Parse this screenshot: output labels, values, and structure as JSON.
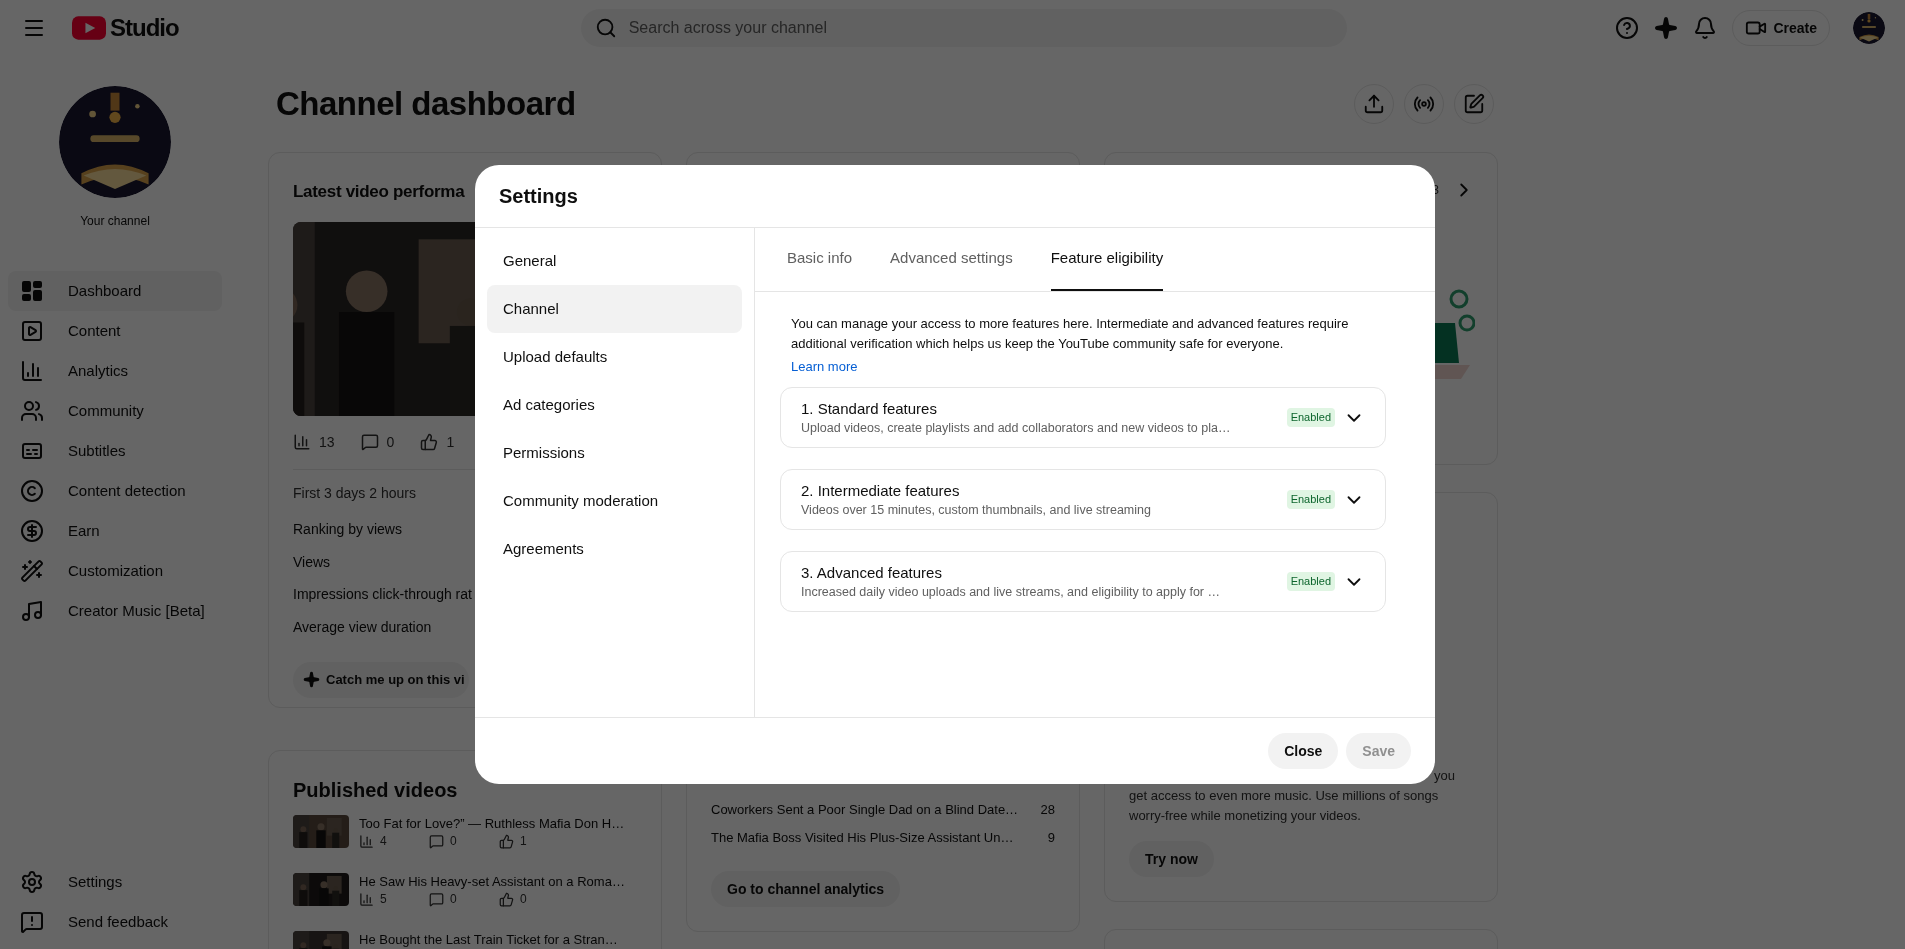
{
  "topbar": {
    "logo": "Studio",
    "search": {
      "placeholder": "Search across your channel"
    },
    "create_button": "Create"
  },
  "sidebar": {
    "channel_label": "Your channel",
    "items": [
      {
        "label": "Dashboard",
        "selected": true
      },
      {
        "label": "Content",
        "selected": false
      },
      {
        "label": "Analytics",
        "selected": false
      },
      {
        "label": "Community",
        "selected": false
      },
      {
        "label": "Subtitles",
        "selected": false
      },
      {
        "label": "Content detection",
        "selected": false
      },
      {
        "label": "Earn",
        "selected": false
      },
      {
        "label": "Customization",
        "selected": false
      },
      {
        "label": "Creator Music [Beta]",
        "selected": false
      }
    ],
    "footer_items": [
      "Settings",
      "Send feedback"
    ]
  },
  "page": {
    "title": "Channel dashboard"
  },
  "latest_video": {
    "title": "Latest video performa",
    "stats": [
      "13",
      "0",
      "1"
    ],
    "period": "First 3 days 2 hours",
    "metrics": [
      "Ranking by views",
      "Views",
      "Impressions click-through rat",
      "Average view duration"
    ],
    "button": "Catch me up on this vi"
  },
  "published_videos": {
    "title": "Published videos",
    "videos": [
      {
        "title": "Too Fat for Love?” — Ruthless Mafia Don H…",
        "stats": [
          "4",
          "0",
          "1"
        ]
      },
      {
        "title": "He Saw His Heavy-set Assistant on a Roma…",
        "stats": [
          "5",
          "0",
          "0"
        ]
      },
      {
        "title": "He Bought the Last Train Ticket for a Stran…"
      }
    ]
  },
  "top_videos": {
    "rows": [
      {
        "title": "Coworkers Sent a Poor Single Dad on a Blind Date…",
        "views": "28"
      },
      {
        "title": "The Mafia Boss Visited His Plus-Size Assistant Un…",
        "views": "9"
      }
    ],
    "button": "Go to channel analytics"
  },
  "news_card": {
    "page_indicator": "3"
  },
  "music_card": {
    "lines": [
      "you",
      "get access to even more music. Use millions of songs",
      "worry-free while monetizing your videos."
    ],
    "button": "Try now"
  },
  "settings_dialog": {
    "title": "Settings",
    "nav": [
      {
        "label": "General",
        "selected": false
      },
      {
        "label": "Channel",
        "selected": true
      },
      {
        "label": "Upload defaults",
        "selected": false
      },
      {
        "label": "Ad categories",
        "selected": false
      },
      {
        "label": "Permissions",
        "selected": false
      },
      {
        "label": "Community moderation",
        "selected": false
      },
      {
        "label": "Agreements",
        "selected": false
      }
    ],
    "tabs": [
      {
        "label": "Basic info",
        "selected": false
      },
      {
        "label": "Advanced settings",
        "selected": false
      },
      {
        "label": "Feature eligibility",
        "selected": true
      }
    ],
    "intro": "You can manage your access to more features here. Intermediate and advanced features require additional verification which helps us keep the YouTube community safe for everyone.",
    "learn_more": "Learn more",
    "features": [
      {
        "title": "1. Standard features",
        "description": "Upload videos, create playlists and add collaborators and new videos to pla…",
        "status": "Enabled",
        "expanded": false
      },
      {
        "title": "2. Intermediate features",
        "description": "Videos over 15 minutes, custom thumbnails, and live streaming",
        "status": "Enabled",
        "expanded": false
      },
      {
        "title": "3. Advanced features",
        "description": "Increased daily video uploads and live streams, and eligibility to apply for …",
        "status": "Enabled",
        "expanded": false
      }
    ],
    "buttons": [
      {
        "label": "Close",
        "disabled": false
      },
      {
        "label": "Save",
        "disabled": true
      }
    ]
  }
}
